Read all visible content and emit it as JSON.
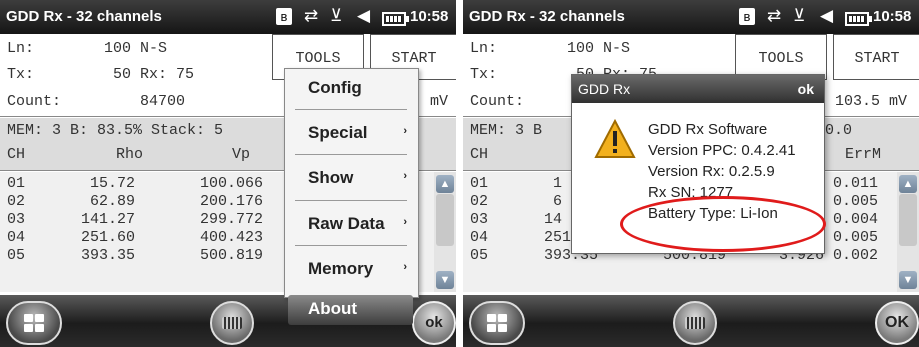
{
  "left": {
    "title": "GDD Rx - 32 channels",
    "clock": "10:58",
    "ln_label": "Ln:",
    "ln_value": "100 N-S",
    "tx_label": "Tx:",
    "tx_value": "50 Rx: 75",
    "count_label": "Count:",
    "count_value": "84700",
    "count_unit": "mV",
    "tools_label": "TOOLS",
    "start_label": "START",
    "mem_line": "MEM: 3 B: 83.5% Stack: 5",
    "col_ch": "CH",
    "col_rho": "Rho",
    "col_vp": "Vp",
    "rows": [
      {
        "ch": "01",
        "rho": "15.72",
        "vp": "100.066"
      },
      {
        "ch": "02",
        "rho": "62.89",
        "vp": "200.176"
      },
      {
        "ch": "03",
        "rho": "141.27",
        "vp": "299.772"
      },
      {
        "ch": "04",
        "rho": "251.60",
        "vp": "400.423"
      },
      {
        "ch": "05",
        "rho": "393.35",
        "vp": "500.819"
      }
    ],
    "ok_label": "ok",
    "menu": [
      "Config",
      "Special",
      "Show",
      "Raw Data",
      "Memory",
      "About"
    ],
    "menu_arrow": "›"
  },
  "right": {
    "title": "GDD Rx - 32 channels",
    "clock": "10:58",
    "ln_label": "Ln:",
    "ln_value": "100 N-S",
    "tx_label": "Tx:",
    "tx_value": "50 Rx: 75",
    "count_label": "Count:",
    "count_value_right": "103.5 mV",
    "tools_label": "TOOLS",
    "start_label": "START",
    "mem_left": "MEM: 3 B",
    "mem_right": "0.0",
    "col_ch": "CH",
    "col_errm": "ErrM",
    "rows": [
      {
        "ch": "01",
        "a": "1",
        "errm": "0.011"
      },
      {
        "ch": "02",
        "a": "6",
        "errm": "0.005"
      },
      {
        "ch": "03",
        "a": "14",
        "errm": "0.004"
      },
      {
        "ch": "04",
        "a": "251",
        "errm": "0.005"
      },
      {
        "ch": "05",
        "a": "393.35",
        "b": "500.819",
        "c": "3.926",
        "errm": "0.002"
      }
    ],
    "ok_label": "OK",
    "dialog": {
      "title": "GDD Rx",
      "ok": "ok",
      "lines": [
        "GDD Rx Software",
        "Version PPC: 0.4.2.41",
        "Version Rx: 0.2.5.9",
        "Rx SN: 1277",
        "Battery Type: Li-Ion"
      ]
    }
  },
  "colors": {
    "highlight": "#e01b1b",
    "titlebar": "#151515",
    "menu_active": "#3d3d3d"
  },
  "icons": [
    "bluetooth-icon",
    "sync-icon",
    "no-signal-icon",
    "volume-icon",
    "battery-icon",
    "windows-start-icon",
    "keyboard-icon",
    "scroll-up-icon",
    "scroll-down-icon",
    "warning-icon"
  ]
}
